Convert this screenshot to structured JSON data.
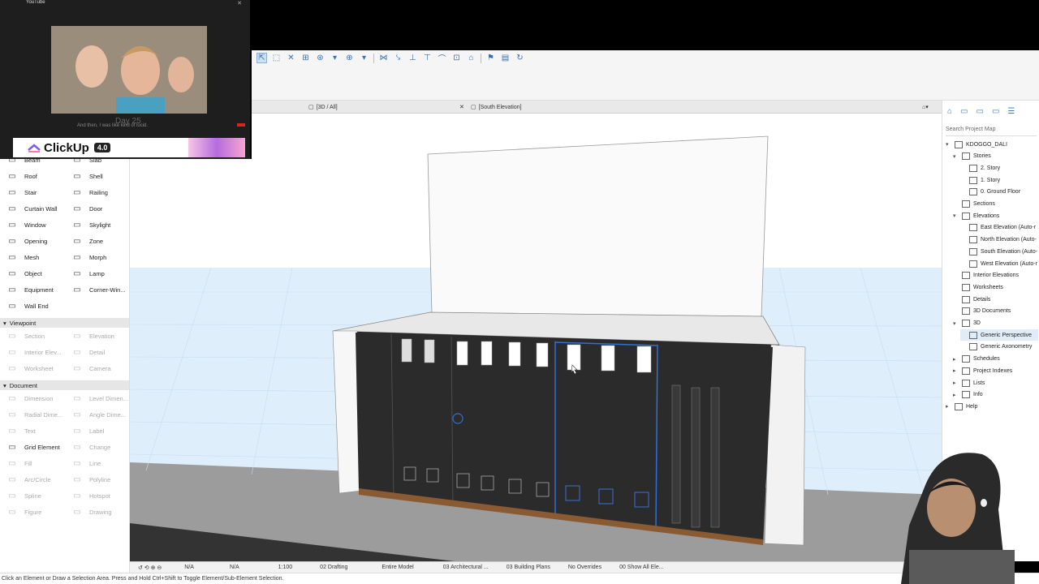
{
  "pip": {
    "title": "YouTube",
    "caption": "And then, I was like kind of lucid.",
    "day_label": "Day 25",
    "banner_brand": "ClickUp",
    "banner_version": "4.0"
  },
  "tabs": [
    {
      "label": "[3D / All]"
    },
    {
      "label": "[South Elevation]"
    }
  ],
  "palette": {
    "design_items": [
      {
        "label": "Beam",
        "icon": "beam-icon"
      },
      {
        "label": "Slab",
        "icon": "slab-icon"
      },
      {
        "label": "Roof",
        "icon": "roof-icon"
      },
      {
        "label": "Shell",
        "icon": "shell-icon"
      },
      {
        "label": "Stair",
        "icon": "stair-icon"
      },
      {
        "label": "Railing",
        "icon": "railing-icon"
      },
      {
        "label": "Curtain Wall",
        "icon": "curtain-wall-icon"
      },
      {
        "label": "Door",
        "icon": "door-icon"
      },
      {
        "label": "Window",
        "icon": "window-icon"
      },
      {
        "label": "Skylight",
        "icon": "skylight-icon"
      },
      {
        "label": "Opening",
        "icon": "opening-icon"
      },
      {
        "label": "Zone",
        "icon": "zone-icon"
      },
      {
        "label": "Mesh",
        "icon": "mesh-icon"
      },
      {
        "label": "Morph",
        "icon": "morph-icon"
      },
      {
        "label": "Object",
        "icon": "object-icon"
      },
      {
        "label": "Lamp",
        "icon": "lamp-icon"
      },
      {
        "label": "Equipment",
        "icon": "equipment-icon"
      },
      {
        "label": "Corner-Win...",
        "icon": "corner-window-icon"
      },
      {
        "label": "Wall End",
        "icon": "wall-end-icon"
      }
    ],
    "viewpoint_header": "Viewpoint",
    "viewpoint_items": [
      {
        "label": "Section"
      },
      {
        "label": "Elevation"
      },
      {
        "label": "Interior Elev..."
      },
      {
        "label": "Detail"
      },
      {
        "label": "Worksheet"
      },
      {
        "label": "Camera"
      }
    ],
    "document_header": "Document",
    "document_items": [
      {
        "label": "Dimension"
      },
      {
        "label": "Level Dimen..."
      },
      {
        "label": "Radial Dime..."
      },
      {
        "label": "Angle Dime..."
      },
      {
        "label": "Text"
      },
      {
        "label": "Label"
      },
      {
        "label": "Grid Element"
      },
      {
        "label": "Change"
      },
      {
        "label": "Fill"
      },
      {
        "label": "Line"
      },
      {
        "label": "Arc/Circle"
      },
      {
        "label": "Polyline"
      },
      {
        "label": "Spline"
      },
      {
        "label": "Hotspot"
      },
      {
        "label": "Figure"
      },
      {
        "label": "Drawing"
      }
    ]
  },
  "navigator": {
    "search_placeholder": "Search Project Map",
    "rows": [
      {
        "label": "KDOGGO_DALI",
        "indent": 0,
        "arrow": "▾"
      },
      {
        "label": "Stories",
        "indent": 1,
        "arrow": "▾"
      },
      {
        "label": "2. Story",
        "indent": 2,
        "arrow": ""
      },
      {
        "label": "1. Story",
        "indent": 2,
        "arrow": ""
      },
      {
        "label": "0. Ground Floor",
        "indent": 2,
        "arrow": ""
      },
      {
        "label": "Sections",
        "indent": 1,
        "arrow": ""
      },
      {
        "label": "Elevations",
        "indent": 1,
        "arrow": "▾"
      },
      {
        "label": "East Elevation (Auto-r",
        "indent": 2,
        "arrow": ""
      },
      {
        "label": "North Elevation (Auto-",
        "indent": 2,
        "arrow": ""
      },
      {
        "label": "South Elevation (Auto-",
        "indent": 2,
        "arrow": ""
      },
      {
        "label": "West Elevation (Auto-r",
        "indent": 2,
        "arrow": ""
      },
      {
        "label": "Interior Elevations",
        "indent": 1,
        "arrow": ""
      },
      {
        "label": "Worksheets",
        "indent": 1,
        "arrow": ""
      },
      {
        "label": "Details",
        "indent": 1,
        "arrow": ""
      },
      {
        "label": "3D Documents",
        "indent": 1,
        "arrow": ""
      },
      {
        "label": "3D",
        "indent": 1,
        "arrow": "▾"
      },
      {
        "label": "Generic Perspective",
        "indent": 2,
        "arrow": "",
        "selected": true
      },
      {
        "label": "Generic Axonometry",
        "indent": 2,
        "arrow": ""
      },
      {
        "label": "Schedules",
        "indent": 1,
        "arrow": "▸"
      },
      {
        "label": "Project Indexes",
        "indent": 1,
        "arrow": "▸"
      },
      {
        "label": "Lists",
        "indent": 1,
        "arrow": "▸"
      },
      {
        "label": "Info",
        "indent": 1,
        "arrow": "▸"
      },
      {
        "label": "Help",
        "indent": 0,
        "arrow": "▸"
      }
    ]
  },
  "bottombar": {
    "scale_value": "N/A",
    "layer_value": "N/A",
    "scale": "1:100",
    "layer_set": "02 Drafting",
    "model_view": "Entire Model",
    "structure": "03 Architectural ...",
    "pen_set": "03 Building Plans",
    "overrides": "No Overrides",
    "renovation": "00 Show All Ele..."
  },
  "status": {
    "text": "Click an Element or Draw a Selection Area. Press and Hold Ctrl+Shift to Toggle Element/Sub-Element Selection."
  },
  "colors": {
    "accent": "#3a6fb0",
    "selection_blue": "#2f6fd6",
    "facade_dark": "#2b2b2b",
    "sky": "#dfeefb"
  }
}
